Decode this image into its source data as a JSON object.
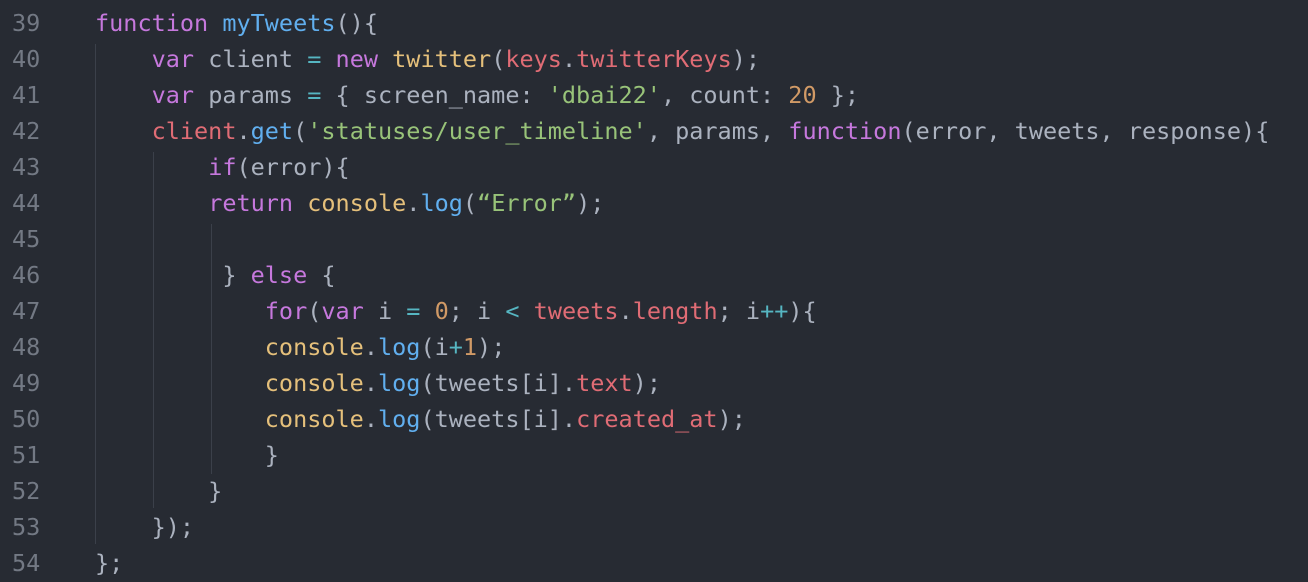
{
  "editor": {
    "theme_colors": {
      "background": "#272b33",
      "line_number": "#737984",
      "keyword": "#c678dd",
      "function_name": "#61afef",
      "object": "#e5c07b",
      "property": "#e06c75",
      "string": "#98c379",
      "number": "#d19a66",
      "operator": "#56b6c2",
      "plain": "#abb2bf"
    },
    "lines": [
      {
        "num": "39",
        "tokens": [
          {
            "t": "function",
            "c": "kw"
          },
          {
            "t": " ",
            "c": "pl"
          },
          {
            "t": "myTweets",
            "c": "def"
          },
          {
            "t": "(){",
            "c": "pl"
          }
        ]
      },
      {
        "num": "40",
        "tokens": [
          {
            "t": "    ",
            "c": "pl"
          },
          {
            "t": "var",
            "c": "kw"
          },
          {
            "t": " client ",
            "c": "pl"
          },
          {
            "t": "=",
            "c": "op"
          },
          {
            "t": " ",
            "c": "pl"
          },
          {
            "t": "new",
            "c": "kw"
          },
          {
            "t": " ",
            "c": "pl"
          },
          {
            "t": "twitter",
            "c": "fn"
          },
          {
            "t": "(",
            "c": "pl"
          },
          {
            "t": "keys",
            "c": "red"
          },
          {
            "t": ".",
            "c": "pl"
          },
          {
            "t": "twitterKeys",
            "c": "red"
          },
          {
            "t": ");",
            "c": "pl"
          }
        ]
      },
      {
        "num": "41",
        "tokens": [
          {
            "t": "    ",
            "c": "pl"
          },
          {
            "t": "var",
            "c": "kw"
          },
          {
            "t": " params ",
            "c": "pl"
          },
          {
            "t": "=",
            "c": "op"
          },
          {
            "t": " { screen_name: ",
            "c": "pl"
          },
          {
            "t": "'dbai22'",
            "c": "str"
          },
          {
            "t": ", count: ",
            "c": "pl"
          },
          {
            "t": "20",
            "c": "num"
          },
          {
            "t": " };",
            "c": "pl"
          }
        ]
      },
      {
        "num": "42",
        "tokens": [
          {
            "t": "    ",
            "c": "pl"
          },
          {
            "t": "client",
            "c": "red"
          },
          {
            "t": ".",
            "c": "pl"
          },
          {
            "t": "get",
            "c": "def"
          },
          {
            "t": "(",
            "c": "pl"
          },
          {
            "t": "'statuses/user_timeline'",
            "c": "str"
          },
          {
            "t": ", params, ",
            "c": "pl"
          },
          {
            "t": "function",
            "c": "kw"
          },
          {
            "t": "(error, tweets, response){",
            "c": "pl"
          }
        ]
      },
      {
        "num": "43",
        "tokens": [
          {
            "t": "        ",
            "c": "pl"
          },
          {
            "t": "if",
            "c": "kw"
          },
          {
            "t": "(error){",
            "c": "pl"
          }
        ]
      },
      {
        "num": "44",
        "tokens": [
          {
            "t": "        ",
            "c": "pl"
          },
          {
            "t": "return",
            "c": "kw"
          },
          {
            "t": " ",
            "c": "pl"
          },
          {
            "t": "console",
            "c": "fn"
          },
          {
            "t": ".",
            "c": "pl"
          },
          {
            "t": "log",
            "c": "def"
          },
          {
            "t": "(",
            "c": "pl"
          },
          {
            "t": "“Error”",
            "c": "str"
          },
          {
            "t": ");",
            "c": "pl"
          }
        ]
      },
      {
        "num": "45",
        "tokens": []
      },
      {
        "num": "46",
        "tokens": [
          {
            "t": "         } ",
            "c": "pl"
          },
          {
            "t": "else",
            "c": "kw"
          },
          {
            "t": " {",
            "c": "pl"
          }
        ]
      },
      {
        "num": "47",
        "tokens": [
          {
            "t": "            ",
            "c": "pl"
          },
          {
            "t": "for",
            "c": "kw"
          },
          {
            "t": "(",
            "c": "pl"
          },
          {
            "t": "var",
            "c": "kw"
          },
          {
            "t": " i ",
            "c": "pl"
          },
          {
            "t": "=",
            "c": "op"
          },
          {
            "t": " ",
            "c": "pl"
          },
          {
            "t": "0",
            "c": "num"
          },
          {
            "t": "; i ",
            "c": "pl"
          },
          {
            "t": "<",
            "c": "op"
          },
          {
            "t": " ",
            "c": "pl"
          },
          {
            "t": "tweets",
            "c": "red"
          },
          {
            "t": ".",
            "c": "pl"
          },
          {
            "t": "length",
            "c": "red"
          },
          {
            "t": "; i",
            "c": "pl"
          },
          {
            "t": "++",
            "c": "op"
          },
          {
            "t": "){",
            "c": "pl"
          }
        ]
      },
      {
        "num": "48",
        "tokens": [
          {
            "t": "            ",
            "c": "pl"
          },
          {
            "t": "console",
            "c": "fn"
          },
          {
            "t": ".",
            "c": "pl"
          },
          {
            "t": "log",
            "c": "def"
          },
          {
            "t": "(i",
            "c": "pl"
          },
          {
            "t": "+",
            "c": "op"
          },
          {
            "t": "1",
            "c": "num"
          },
          {
            "t": ");",
            "c": "pl"
          }
        ]
      },
      {
        "num": "49",
        "tokens": [
          {
            "t": "            ",
            "c": "pl"
          },
          {
            "t": "console",
            "c": "fn"
          },
          {
            "t": ".",
            "c": "pl"
          },
          {
            "t": "log",
            "c": "def"
          },
          {
            "t": "(tweets[i].",
            "c": "pl"
          },
          {
            "t": "text",
            "c": "red"
          },
          {
            "t": ");",
            "c": "pl"
          }
        ]
      },
      {
        "num": "50",
        "tokens": [
          {
            "t": "            ",
            "c": "pl"
          },
          {
            "t": "console",
            "c": "fn"
          },
          {
            "t": ".",
            "c": "pl"
          },
          {
            "t": "log",
            "c": "def"
          },
          {
            "t": "(tweets[i].",
            "c": "pl"
          },
          {
            "t": "created_at",
            "c": "red"
          },
          {
            "t": ");",
            "c": "pl"
          }
        ]
      },
      {
        "num": "51",
        "tokens": [
          {
            "t": "            }",
            "c": "pl"
          }
        ]
      },
      {
        "num": "52",
        "tokens": [
          {
            "t": "        }",
            "c": "pl"
          }
        ]
      },
      {
        "num": "53",
        "tokens": [
          {
            "t": "    });",
            "c": "pl"
          }
        ]
      },
      {
        "num": "54",
        "tokens": [
          {
            "t": "};",
            "c": "pl"
          }
        ]
      }
    ]
  }
}
